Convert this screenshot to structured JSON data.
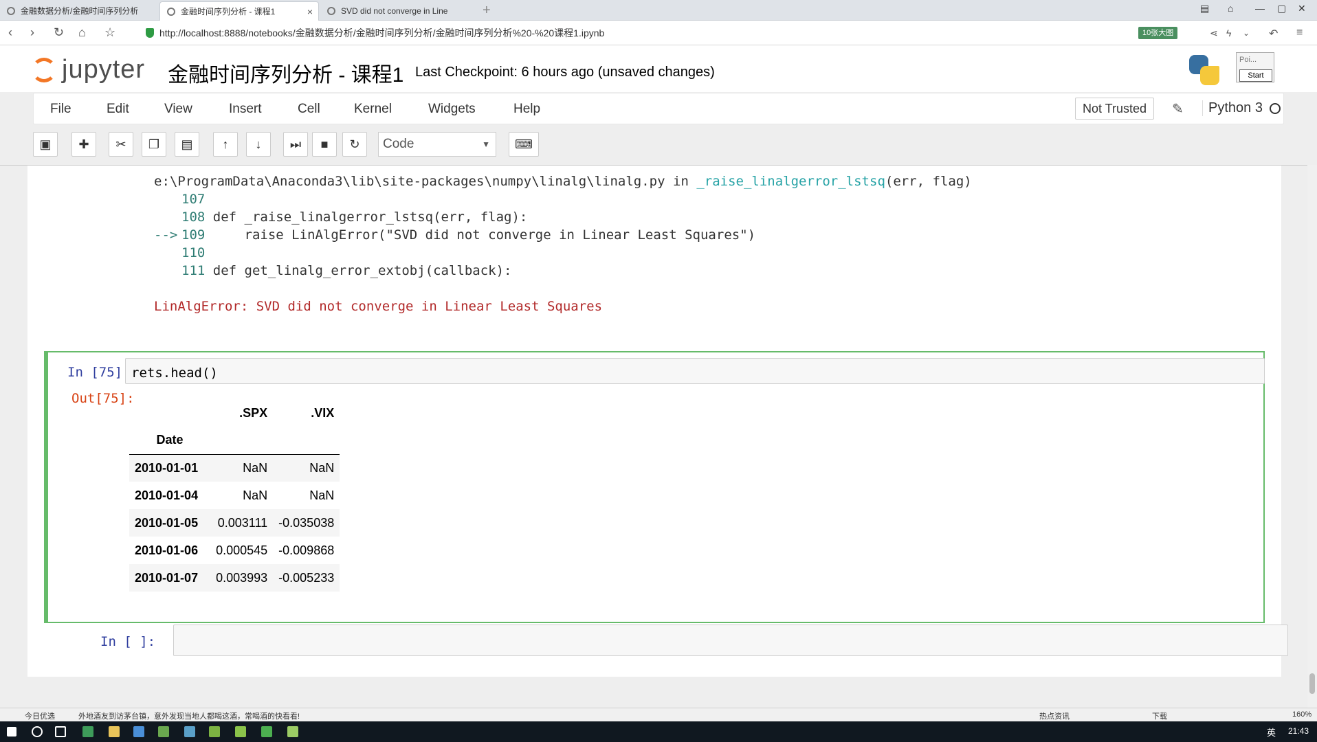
{
  "browser": {
    "tabs": [
      {
        "label": "金融数据分析/金融时间序列分析"
      },
      {
        "label": "金融时间序列分析 - 课程1"
      },
      {
        "label": "SVD did not converge in Line"
      }
    ],
    "url": "http://localhost:8888/notebooks/金融数据分析/金融时间序列分析/金融时间序列分析%20-%20课程1.ipynb",
    "url_badge": "10张大图"
  },
  "header": {
    "logo_text": "jupyter",
    "notebook_title": "金融时间序列分析 - 课程1",
    "checkpoint": "Last Checkpoint: 6 hours ago (unsaved changes)",
    "popup_text": "Poi...",
    "popup_button": "Start"
  },
  "menubar": {
    "items": [
      "File",
      "Edit",
      "View",
      "Insert",
      "Cell",
      "Kernel",
      "Widgets",
      "Help"
    ],
    "trust": "Not Trusted",
    "kernel": "Python 3"
  },
  "toolbar": {
    "cell_type": "Code",
    "buttons": [
      "save-icon",
      "add-icon",
      "cut-icon",
      "copy-icon",
      "paste-icon",
      "move-up-icon",
      "move-down-icon",
      "run-icon",
      "stop-icon",
      "restart-icon",
      "keyboard-icon"
    ]
  },
  "traceback": {
    "file_line": "e:\\ProgramData\\Anaconda3\\lib\\site-packages\\numpy\\linalg\\linalg.py",
    "in_word": "in",
    "func": "_raise_linalgerror_lstsq",
    "func_args": "(err, flag)",
    "lines": [
      {
        "arrow": "",
        "num": "107",
        "code": ""
      },
      {
        "arrow": "",
        "num": "108",
        "code": "def _raise_linalgerror_lstsq(err, flag):"
      },
      {
        "arrow": "-->",
        "num": "109",
        "code": "    raise LinAlgError(\"SVD did not converge in Linear Least Squares\")"
      },
      {
        "arrow": "",
        "num": "110",
        "code": ""
      },
      {
        "arrow": "",
        "num": "111",
        "code": "def get_linalg_error_extobj(callback):"
      }
    ],
    "error": "LinAlgError: SVD did not converge in Linear Least Squares"
  },
  "cell75": {
    "in_prompt": "In [75]:",
    "out_prompt": "Out[75]:",
    "code": "rets.head()",
    "table": {
      "columns": [
        ".SPX",
        ".VIX"
      ],
      "index_name": "Date",
      "rows": [
        {
          "date": "2010-01-01",
          "spx": "NaN",
          "vix": "NaN"
        },
        {
          "date": "2010-01-04",
          "spx": "NaN",
          "vix": "NaN"
        },
        {
          "date": "2010-01-05",
          "spx": "0.003111",
          "vix": "-0.035038"
        },
        {
          "date": "2010-01-06",
          "spx": "0.000545",
          "vix": "-0.009868"
        },
        {
          "date": "2010-01-07",
          "spx": "0.003993",
          "vix": "-0.005233"
        }
      ]
    }
  },
  "empty_cell": {
    "in_prompt": "In [ ]:"
  },
  "statusbar": {
    "left": "今日优选",
    "news": "外地酒友到访茅台镇，意外发现当地人都喝这酒，常喝酒的快看看!",
    "hot": "热点资讯",
    "download": "下载",
    "zoom": "160%"
  },
  "taskbar": {
    "ime": "英",
    "time": "21:43"
  }
}
